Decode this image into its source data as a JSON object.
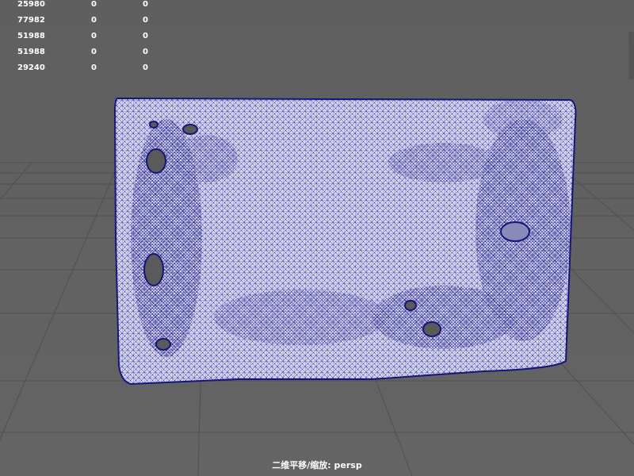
{
  "viewport": {
    "background_color": "#646464",
    "grid_color": "#4a4a4a",
    "mesh_fill_color": "#cfd0f0",
    "mesh_wire_color": "#1f1f8c",
    "camera_label": "二维平移/缩放: persp"
  },
  "heads_up_display": {
    "rows": [
      {
        "value": "25980",
        "col2": "0",
        "col3": "0"
      },
      {
        "value": "77982",
        "col2": "0",
        "col3": "0"
      },
      {
        "value": "51988",
        "col2": "0",
        "col3": "0"
      },
      {
        "value": "51988",
        "col2": "0",
        "col3": "0"
      },
      {
        "value": "29240",
        "col2": "0",
        "col3": "0"
      }
    ]
  }
}
